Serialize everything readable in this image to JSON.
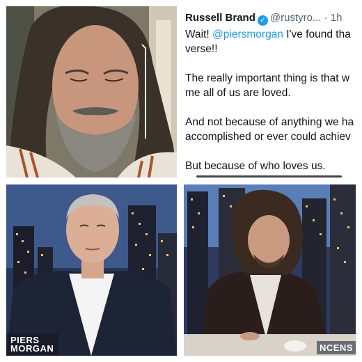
{
  "tweet": {
    "name": "Russell Brand",
    "handle": "@rustyro...",
    "time": "· 1h",
    "line1_a": "Wait! ",
    "mention": "@piersmorgan",
    "line1_b": " I've found tha",
    "line2": "verse!!",
    "para2_line1": "The really important thing is that w",
    "para2_line2": "me all of us are loved.",
    "para3_line1": "And not because of anything we ha",
    "para3_line2": "accomplished or ever could achiev",
    "para4_line1": "But because of who loves us."
  },
  "lower_left": {
    "caption_line1": "PIERS",
    "caption_line2": "MORGAN"
  },
  "lower_right": {
    "caption": "NCENS"
  },
  "colors": {
    "verified": "#1d9bf0",
    "mention": "#1d9bf0"
  },
  "icons": {
    "verified": "verified-badge-icon"
  }
}
